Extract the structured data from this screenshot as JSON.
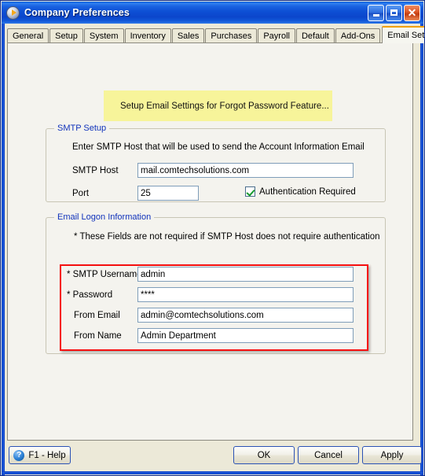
{
  "window": {
    "title": "Company Preferences",
    "icon": "play-circle-icon",
    "controls": {
      "minimize": "minimize-icon",
      "maximize": "maximize-icon",
      "close": "close-icon"
    }
  },
  "tabs": [
    {
      "label": "General",
      "active": false
    },
    {
      "label": "Setup",
      "active": false
    },
    {
      "label": "System",
      "active": false
    },
    {
      "label": "Inventory",
      "active": false
    },
    {
      "label": "Sales",
      "active": false
    },
    {
      "label": "Purchases",
      "active": false
    },
    {
      "label": "Payroll",
      "active": false
    },
    {
      "label": "Default",
      "active": false
    },
    {
      "label": "Add-Ons",
      "active": false
    },
    {
      "label": "Email Setup",
      "active": true
    }
  ],
  "notice": {
    "text": "Setup Email Settings for Forgot Password Feature...",
    "background": "#f7f49a"
  },
  "smtp_setup": {
    "legend": "SMTP Setup",
    "hint": "Enter SMTP Host that will be used to send the Account Information Email",
    "host_label": "SMTP Host",
    "host_value": "mail.comtechsolutions.com",
    "port_label": "Port",
    "port_value": "25",
    "auth_label": "Authentication Required",
    "auth_checked": true
  },
  "email_logon": {
    "legend": "Email Logon Information",
    "hint": "* These Fields are not required if SMTP Host does not require authentication",
    "fields": [
      {
        "label": "* SMTP Username",
        "value": "admin"
      },
      {
        "label": "* Password",
        "value": "****"
      },
      {
        "label": "From Email",
        "value": "admin@comtechsolutions.com"
      },
      {
        "label": "From Name",
        "value": "Admin Department"
      }
    ],
    "highlight_color": "#f50f0f"
  },
  "buttons": {
    "help": "F1 - Help",
    "help_icon": "question-mark-icon",
    "ok": "OK",
    "cancel": "Cancel",
    "apply": "Apply"
  }
}
